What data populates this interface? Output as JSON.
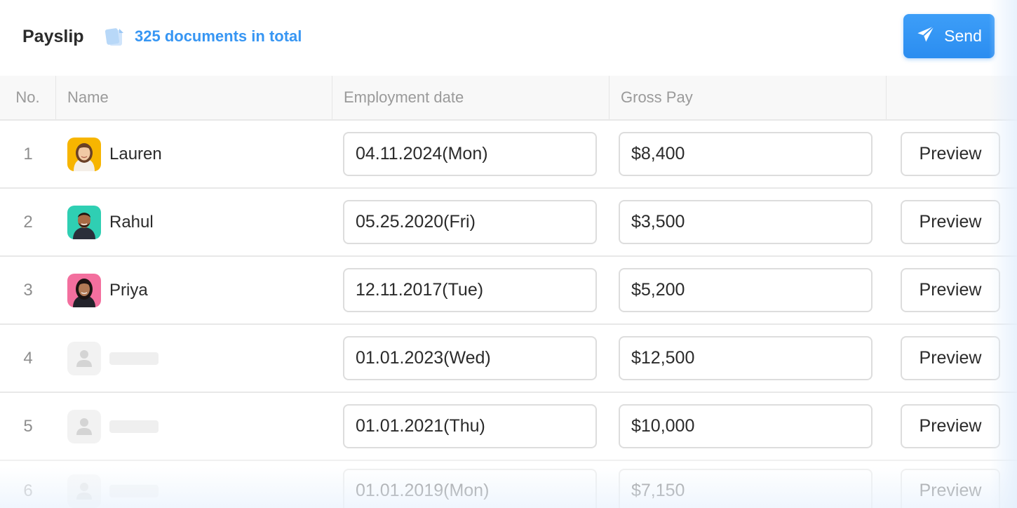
{
  "header": {
    "title": "Payslip",
    "doc_count": "325 documents in total",
    "doc_icon": "document-icon",
    "send_label": "Send",
    "send_icon": "send-paper-plane-icon",
    "accent_color": "#3796f3"
  },
  "table": {
    "columns": {
      "no": "No.",
      "name": "Name",
      "date": "Employment date",
      "gross": "Gross Pay",
      "action": ""
    },
    "rows": [
      {
        "no": "1",
        "name": "Lauren",
        "date": "04.11.2024(Mon)",
        "gross": "$8,400",
        "action": "Preview",
        "avatar": "avatar-lauren"
      },
      {
        "no": "2",
        "name": "Rahul",
        "date": "05.25.2020(Fri)",
        "gross": "$3,500",
        "action": "Preview",
        "avatar": "avatar-rahul"
      },
      {
        "no": "3",
        "name": "Priya",
        "date": "12.11.2017(Tue)",
        "gross": "$5,200",
        "action": "Preview",
        "avatar": "avatar-priya"
      },
      {
        "no": "4",
        "name": "",
        "date": "01.01.2023(Wed)",
        "gross": "$12,500",
        "action": "Preview",
        "avatar": "user-placeholder-icon"
      },
      {
        "no": "5",
        "name": "",
        "date": "01.01.2021(Thu)",
        "gross": "$10,000",
        "action": "Preview",
        "avatar": "user-placeholder-icon"
      },
      {
        "no": "6",
        "name": "",
        "date": "01.01.2019(Mon)",
        "gross": "$7,150",
        "action": "Preview",
        "avatar": "user-placeholder-icon"
      }
    ]
  }
}
